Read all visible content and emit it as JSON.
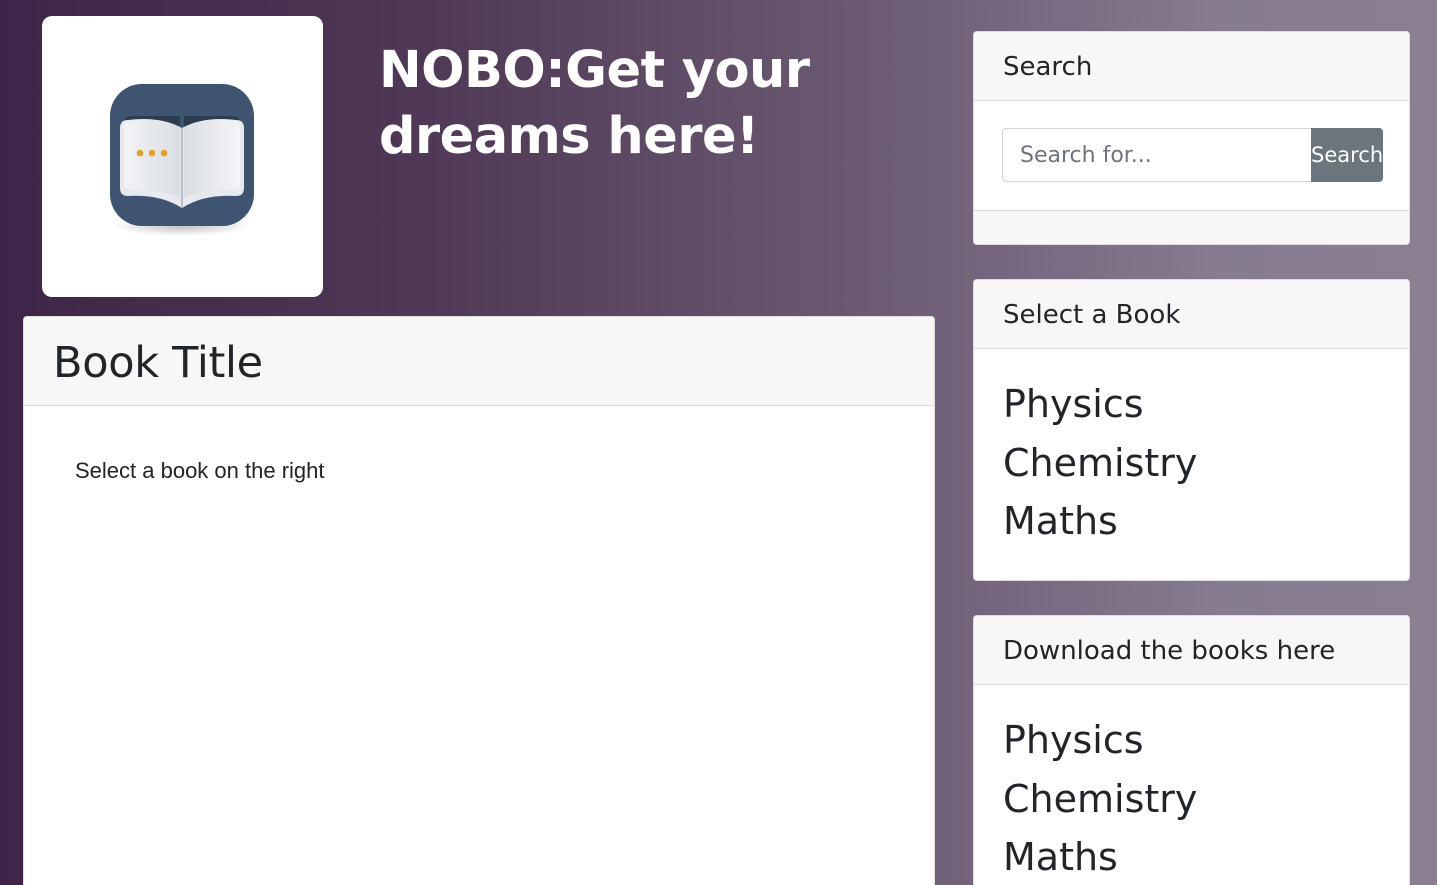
{
  "header": {
    "title": "NOBO:Get your dreams here!"
  },
  "main": {
    "card_title": "Book Title",
    "body_text": "Select a book on the right"
  },
  "sidebar": {
    "search": {
      "title": "Search",
      "placeholder": "Search for...",
      "button_label": "Search"
    },
    "select_book": {
      "title": "Select a Book",
      "items": [
        "Physics",
        "Chemistry",
        "Maths"
      ]
    },
    "download": {
      "title": "Download the books here",
      "items": [
        "Physics",
        "Chemistry",
        "Maths"
      ]
    }
  },
  "colors": {
    "background_start": "#3e2547",
    "background_end": "#8a8091",
    "logo_book_tile": "#3f5470",
    "logo_dots": "#e8a020",
    "search_button": "#6c757d"
  },
  "icons": {
    "logo": "book-app-icon"
  }
}
